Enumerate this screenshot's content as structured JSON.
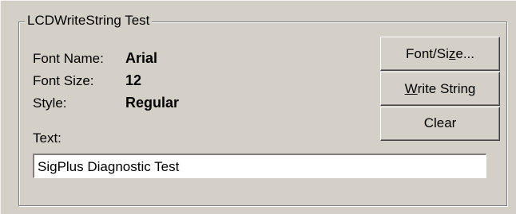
{
  "group": {
    "title": "LCDWriteString Test"
  },
  "font_info": {
    "name_label": "Font Name:",
    "name_value": "Arial",
    "size_label": "Font Size:",
    "size_value": "12",
    "style_label": "Style:",
    "style_value": "Regular"
  },
  "buttons": {
    "font_size": {
      "prefix": "Font/Si",
      "mnemonic": "z",
      "suffix": "e..."
    },
    "write_string": {
      "prefix": "",
      "mnemonic": "W",
      "suffix": "rite String"
    },
    "clear": {
      "label": "Clear"
    }
  },
  "text_field": {
    "label": "Text:",
    "value": "SigPlus Diagnostic Test"
  },
  "colors": {
    "window_bg": "#d4d0c8",
    "field_bg": "#ffffff",
    "text": "#000000"
  }
}
